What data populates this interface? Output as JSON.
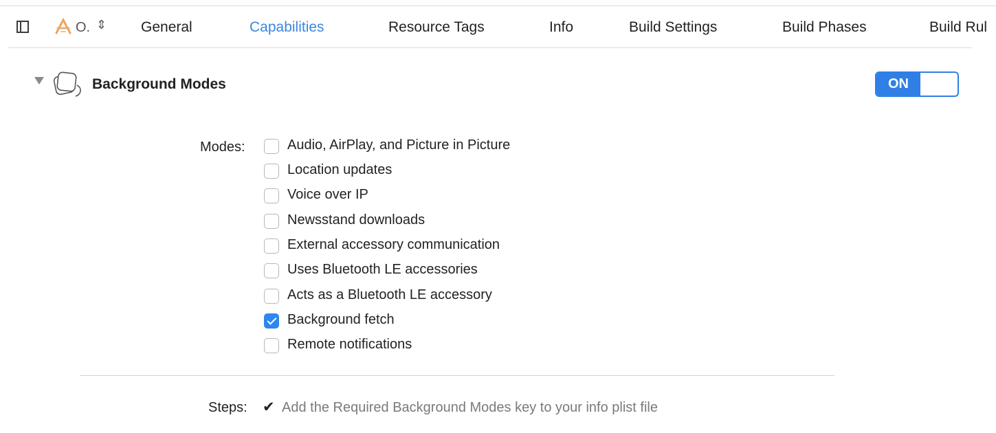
{
  "tabbar": {
    "target_name": "O.",
    "tabs": [
      {
        "label": "General"
      },
      {
        "label": "Capabilities"
      },
      {
        "label": "Resource Tags"
      },
      {
        "label": "Info"
      },
      {
        "label": "Build Settings"
      },
      {
        "label": "Build Phases"
      },
      {
        "label": "Build Rul"
      }
    ],
    "active_tab": "Capabilities"
  },
  "capability": {
    "title": "Background Modes",
    "toggle_label": "ON",
    "toggle_state": "on",
    "modes_label": "Modes:",
    "modes": [
      {
        "label": "Audio, AirPlay, and Picture in Picture",
        "checked": false
      },
      {
        "label": "Location updates",
        "checked": false
      },
      {
        "label": "Voice over IP",
        "checked": false
      },
      {
        "label": "Newsstand downloads",
        "checked": false
      },
      {
        "label": "External accessory communication",
        "checked": false
      },
      {
        "label": "Uses Bluetooth LE accessories",
        "checked": false
      },
      {
        "label": "Acts as a Bluetooth LE accessory",
        "checked": false
      },
      {
        "label": "Background fetch",
        "checked": true
      },
      {
        "label": "Remote notifications",
        "checked": false
      }
    ],
    "steps_label": "Steps:",
    "steps": [
      {
        "mark": "✔",
        "text": "Add the Required Background Modes key to your info plist file"
      }
    ]
  },
  "colors": {
    "accent": "#2f7fe6",
    "active_tab": "#3a86e0"
  },
  "icons": {
    "sidebar_toggle": "sidebar-toggle-icon",
    "target": "app-target-icon",
    "updown": "chevron-updown-icon",
    "disclosure": "disclosure-triangle-icon",
    "capability": "background-modes-icon",
    "checkmark": "checkmark-icon"
  }
}
